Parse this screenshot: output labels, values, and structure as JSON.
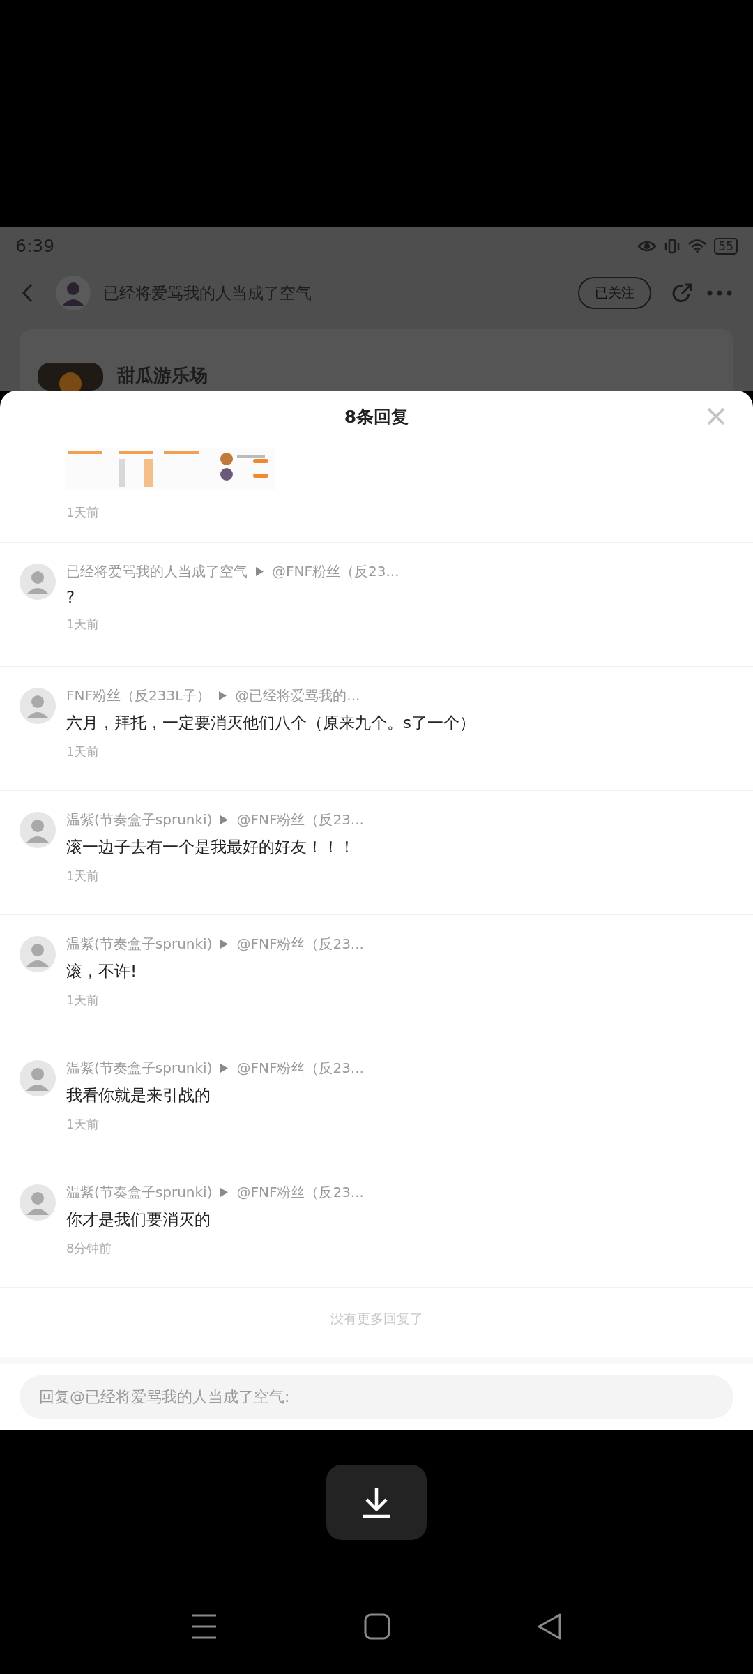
{
  "status_bar": {
    "time": "6:39",
    "battery": "55"
  },
  "header": {
    "title": "已经将爱骂我的人当成了空气",
    "follow_button": "已关注"
  },
  "post": {
    "author": "甜瓜游乐场"
  },
  "sheet": {
    "title": "8条回复",
    "first_reply_time": "1天前",
    "replies": [
      {
        "author": "已经将爱骂我的人当成了空气",
        "target": "@FNF粉丝（反23...",
        "text": "?",
        "time": "1天前"
      },
      {
        "author": "FNF粉丝（反233L子）",
        "target": "@已经将爱骂我的...",
        "text": "六月，拜托，一定要消灭他们八个（原来九个。s了一个）",
        "time": "1天前"
      },
      {
        "author": "温紫(节奏盒子sprunki)",
        "target": "@FNF粉丝（反23...",
        "text": "滚一边子去有一个是我最好的好友！！！",
        "time": "1天前"
      },
      {
        "author": "温紫(节奏盒子sprunki)",
        "target": "@FNF粉丝（反23...",
        "text": "滚，不许!",
        "time": "1天前"
      },
      {
        "author": "温紫(节奏盒子sprunki)",
        "target": "@FNF粉丝（反23...",
        "text": "我看你就是来引战的",
        "time": "1天前"
      },
      {
        "author": "温紫(节奏盒子sprunki)",
        "target": "@FNF粉丝（反23...",
        "text": "你才是我们要消灭的",
        "time": "8分钟前"
      }
    ],
    "end_note": "没有更多回复了",
    "reply_field": {
      "placeholder": "回复@已经将爱骂我的人当成了空气:"
    }
  }
}
